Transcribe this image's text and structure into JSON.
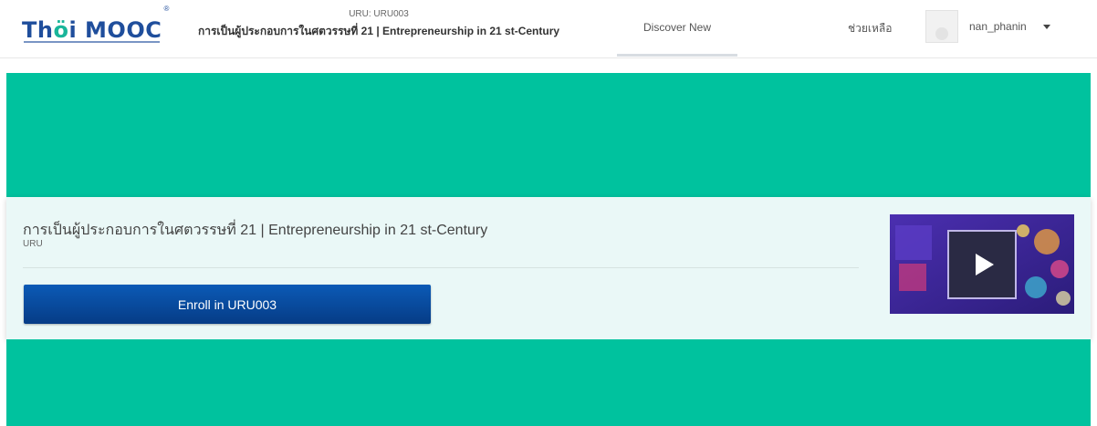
{
  "header": {
    "logo": {
      "part1": "Th",
      "part2": "ö",
      "part3": "i MOOC"
    },
    "course_code": "URU: URU003",
    "course_title": "การเป็นผู้ประกอบการในศตวรรษที่ 21 | Entrepreneurship in 21 st-Century",
    "nav": {
      "discover_label": "Discover New"
    },
    "help_label": "ช่วยเหลือ",
    "user": {
      "name": "nan_phanin"
    }
  },
  "course": {
    "title": "การเป็นผู้ประกอบการในศตวรรษที่ 21 | Entrepreneurship in 21 st-Century",
    "org": "URU",
    "enroll_label": "Enroll in URU003"
  },
  "colors": {
    "hero": "#00c29e",
    "card": "#eaf8f7",
    "button": "#063c86",
    "logo_blue": "#1f4e9c",
    "logo_green": "#19b59a"
  },
  "icons": {
    "play": "play-icon",
    "caret": "caret-down-icon",
    "avatar": "user-avatar-icon"
  }
}
